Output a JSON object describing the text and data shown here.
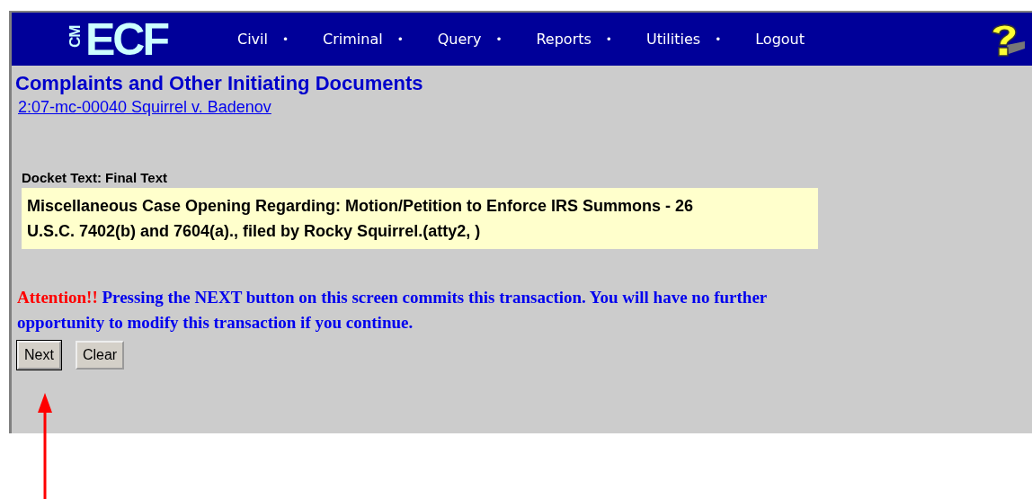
{
  "banner": {
    "logo_small": "CM",
    "logo": "ECF",
    "nav": [
      "Civil",
      "Criminal",
      "Query",
      "Reports",
      "Utilities",
      "Logout"
    ],
    "separator": "•"
  },
  "page": {
    "title": "Complaints and Other Initiating Documents",
    "case_link": "2:07-mc-00040 Squirrel v. Badenov"
  },
  "docket": {
    "label": "Docket Text: Final Text",
    "text": "Miscellaneous Case Opening Regarding: Motion/Petition to Enforce IRS Summons - 26 U.S.C. 7402(b) and 7604(a)., filed by Rocky Squirrel.(atty2, )"
  },
  "notice": {
    "label": "Attention!!",
    "text": "Pressing the NEXT button on this screen commits this transaction. You will have no further opportunity to modify this transaction if you continue."
  },
  "buttons": [
    {
      "label": "Next",
      "default": true
    },
    {
      "label": "Clear",
      "default": false
    }
  ],
  "annotation": {
    "kind": "arrow"
  }
}
